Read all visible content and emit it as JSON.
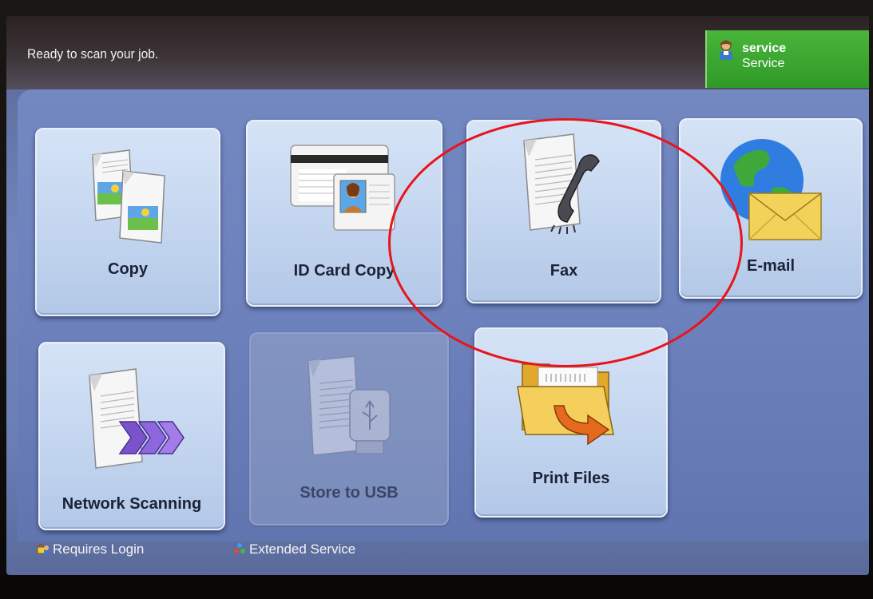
{
  "status": {
    "message": "Ready to scan your job."
  },
  "user": {
    "name": "service",
    "role": "Service"
  },
  "tiles": [
    {
      "label": "Copy"
    },
    {
      "label": "ID Card Copy"
    },
    {
      "label": "Fax"
    },
    {
      "label": "E-mail"
    },
    {
      "label": "Network Scanning"
    },
    {
      "label": "Store to USB"
    },
    {
      "label": "Print Files"
    }
  ],
  "legend": {
    "requires_login": "Requires Login",
    "extended_service": "Extended Service"
  },
  "colors": {
    "screen_background": "#6d82bd",
    "user_badge": "#3aa82f",
    "annotation": "#e8141a"
  }
}
